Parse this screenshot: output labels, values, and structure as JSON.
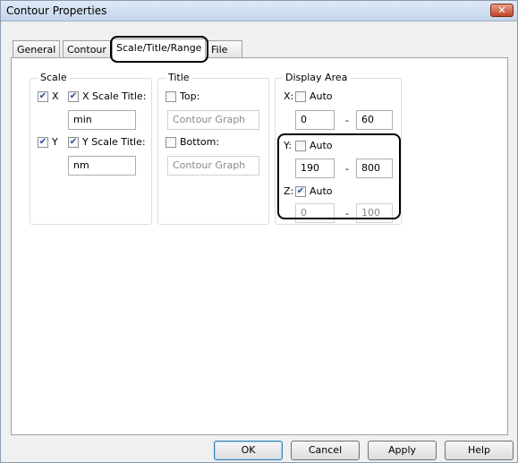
{
  "window": {
    "title": "Contour Properties",
    "close_glyph": "✕"
  },
  "tabs": [
    {
      "label": "General"
    },
    {
      "label": "Contour"
    },
    {
      "label": "Scale/Title/Range",
      "active": true
    },
    {
      "label": "File"
    }
  ],
  "scale": {
    "group_label": "Scale",
    "x_check_label": "X",
    "x_checked": true,
    "x_title_check_label": "X Scale Title:",
    "x_title_checked": true,
    "x_title_value": "min",
    "y_check_label": "Y",
    "y_checked": true,
    "y_title_check_label": "Y Scale Title:",
    "y_title_checked": true,
    "y_title_value": "nm"
  },
  "title_group": {
    "group_label": "Title",
    "top_label": "Top:",
    "top_checked": false,
    "top_value": "Contour Graph",
    "bottom_label": "Bottom:",
    "bottom_checked": false,
    "bottom_value": "Contour Graph"
  },
  "display_area": {
    "group_label": "Display Area",
    "x_label": "X:",
    "x_auto_label": "Auto",
    "x_auto": false,
    "x_min": "0",
    "x_max": "60",
    "y_label": "Y:",
    "y_auto_label": "Auto",
    "y_auto": false,
    "y_min": "190",
    "y_max": "800",
    "z_label": "Z:",
    "z_auto_label": "Auto",
    "z_auto": true,
    "z_min": "0",
    "z_max": "100",
    "dash": "-"
  },
  "buttons": {
    "ok": "OK",
    "cancel": "Cancel",
    "apply": "Apply",
    "help": "Help"
  },
  "check_glyph": "✔"
}
